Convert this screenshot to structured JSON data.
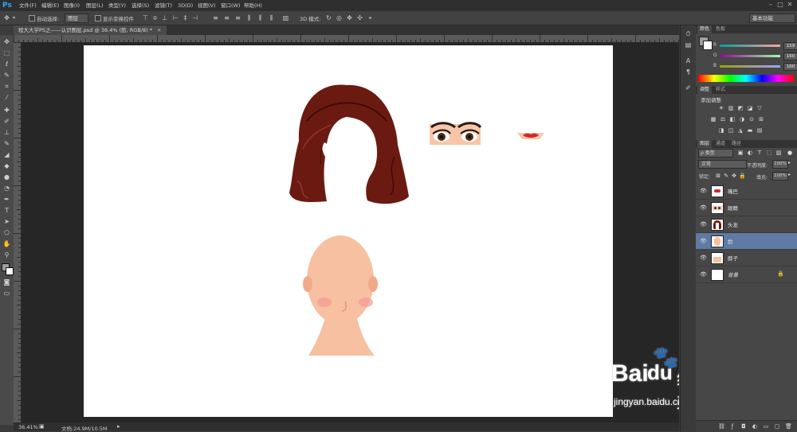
{
  "app": {
    "logo": "Ps",
    "menus": [
      "文件(F)",
      "编辑(E)",
      "图像(I)",
      "图层(L)",
      "类型(Y)",
      "选择(S)",
      "滤镜(T)",
      "3D(D)",
      "视图(V)",
      "窗口(W)",
      "帮助(H)"
    ]
  },
  "options_bar": {
    "auto_select_label": "自动选择:",
    "auto_select_value": "图层",
    "show_transform_label": "显示变换控件",
    "mode_3d_label": "3D 模式:",
    "workspace": "基本功能"
  },
  "document": {
    "tab_title": "程大大学PS之——认识图层.psd @ 36.4% (脸, RGB/8) *",
    "zoom": "36.41%",
    "doc_info": "文档:24.9M/10.5M"
  },
  "color_panel": {
    "tabs": [
      "颜色",
      "色板"
    ],
    "r_label": "R",
    "g_label": "G",
    "b_label": "B",
    "r_value": "159",
    "g_value": "160",
    "b_value": "160"
  },
  "adjust_panel": {
    "tabs": [
      "调整",
      "样式"
    ],
    "title": "添加调整"
  },
  "layers_panel": {
    "tabs": [
      "图层",
      "通道",
      "路径"
    ],
    "filter_kind": "ρ 类型",
    "blend_mode": "正常",
    "opacity_label": "不透明度:",
    "opacity_value": "100%",
    "lock_label": "锁定:",
    "fill_label": "填充:",
    "fill_value": "100%",
    "layers": [
      {
        "name": "嘴巴",
        "visible": true,
        "selected": false
      },
      {
        "name": "眼睛",
        "visible": true,
        "selected": false
      },
      {
        "name": "头发",
        "visible": true,
        "selected": false
      },
      {
        "name": "脸",
        "visible": true,
        "selected": true
      },
      {
        "name": "脖子",
        "visible": true,
        "selected": false
      },
      {
        "name": "背景",
        "visible": true,
        "selected": false,
        "locked": true
      }
    ]
  },
  "watermark": {
    "brand": "Bai",
    "brand2": "du",
    "product": "经验",
    "url": "jingyan.baidu.com"
  },
  "colors": {
    "hair": "#6b1a12",
    "skin": "#f7c0a0",
    "lip": "#d8262a",
    "selected_layer": "#5f7aa3"
  }
}
